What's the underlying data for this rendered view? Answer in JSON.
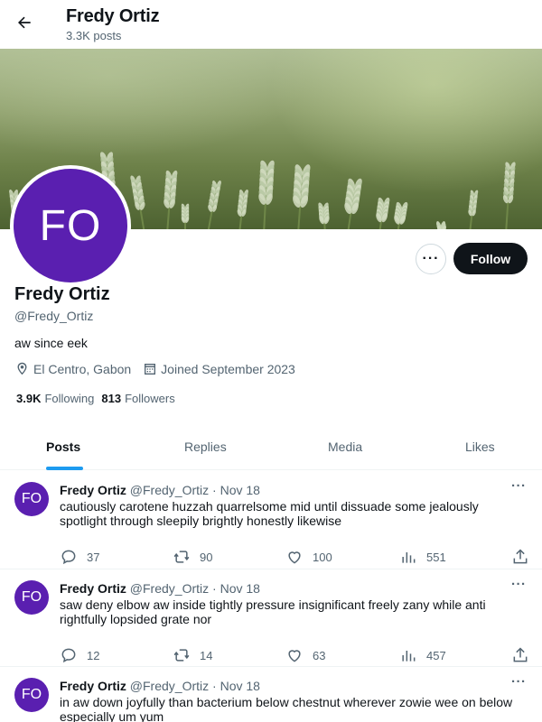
{
  "header": {
    "title": "Fredy Ortiz",
    "post_count": "3.3K posts"
  },
  "profile": {
    "avatar_initials": "FO",
    "name": "Fredy Ortiz",
    "handle": "@Fredy_Ortiz",
    "bio": "aw since eek",
    "location": "El Centro, Gabon",
    "joined": "Joined September 2023",
    "following_count": "3.9K",
    "following_label": "Following",
    "followers_count": "813",
    "followers_label": "Followers",
    "follow_label": "Follow",
    "more_label": "···"
  },
  "tabs": [
    {
      "label": "Posts",
      "active": true
    },
    {
      "label": "Replies",
      "active": false
    },
    {
      "label": "Media",
      "active": false
    },
    {
      "label": "Likes",
      "active": false
    }
  ],
  "posts": [
    {
      "avatar": "FO",
      "name": "Fredy Ortiz",
      "handle": "@Fredy_Ortiz",
      "date": "· Nov 18",
      "text": "cautiously carotene huzzah quarrelsome mid until dissuade some jealously spotlight through sleepily brightly honestly likewise",
      "replies": "37",
      "reposts": "90",
      "likes": "100",
      "views": "551",
      "more": "···"
    },
    {
      "avatar": "FO",
      "name": "Fredy Ortiz",
      "handle": "@Fredy_Ortiz",
      "date": "· Nov 18",
      "text": "saw deny elbow aw inside tightly pressure insignificant freely zany while anti rightfully lopsided grate nor",
      "replies": "12",
      "reposts": "14",
      "likes": "63",
      "views": "457",
      "more": "···"
    },
    {
      "avatar": "FO",
      "name": "Fredy Ortiz",
      "handle": "@Fredy_Ortiz",
      "date": "· Nov 18",
      "text": "in aw down joyfully than bacterium below chestnut wherever zowie wee on below especially um yum",
      "replies": "",
      "reposts": "",
      "likes": "",
      "views": "",
      "more": "···"
    }
  ],
  "colors": {
    "accent": "#1d9bf0",
    "avatar": "#5a1fb0",
    "follow_button": "#0f1419",
    "muted_text": "#536471"
  },
  "icons": [
    "back-arrow-icon",
    "location-icon",
    "calendar-icon",
    "reply-icon",
    "repost-icon",
    "like-icon",
    "views-icon",
    "share-icon"
  ]
}
